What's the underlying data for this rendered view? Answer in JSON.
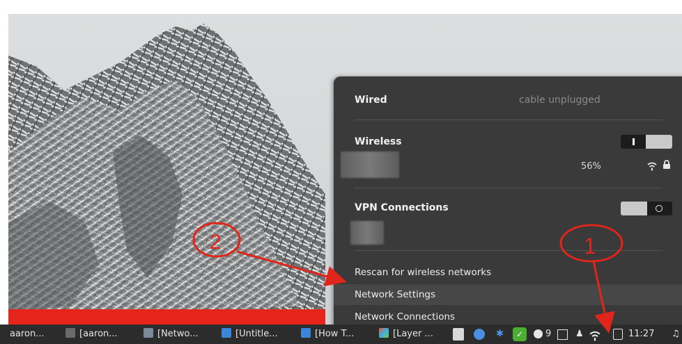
{
  "network_menu": {
    "wired": {
      "title": "Wired",
      "status": "cable unplugged"
    },
    "wireless": {
      "title": "Wireless",
      "enabled": true,
      "network": {
        "signal": "56%",
        "secured": true
      }
    },
    "vpn": {
      "title": "VPN Connections",
      "enabled": false
    },
    "actions": [
      "Rescan for wireless networks",
      "Network Settings",
      "Network Connections"
    ]
  },
  "annotations": {
    "step1": "1",
    "step2": "2"
  },
  "taskbar": {
    "tasks": [
      "aaron...",
      "[aaron...",
      "[Netwo...",
      "[Untitle...",
      "[How T...",
      "[Layer ..."
    ],
    "tray": {
      "notifications_count": "9",
      "clock": "11:27"
    }
  },
  "colors": {
    "popup_bg": "#3a3a3a",
    "taskbar_bg": "#2c2c2c",
    "annotation_red": "#e0251b",
    "red_bar": "#e5251b"
  }
}
